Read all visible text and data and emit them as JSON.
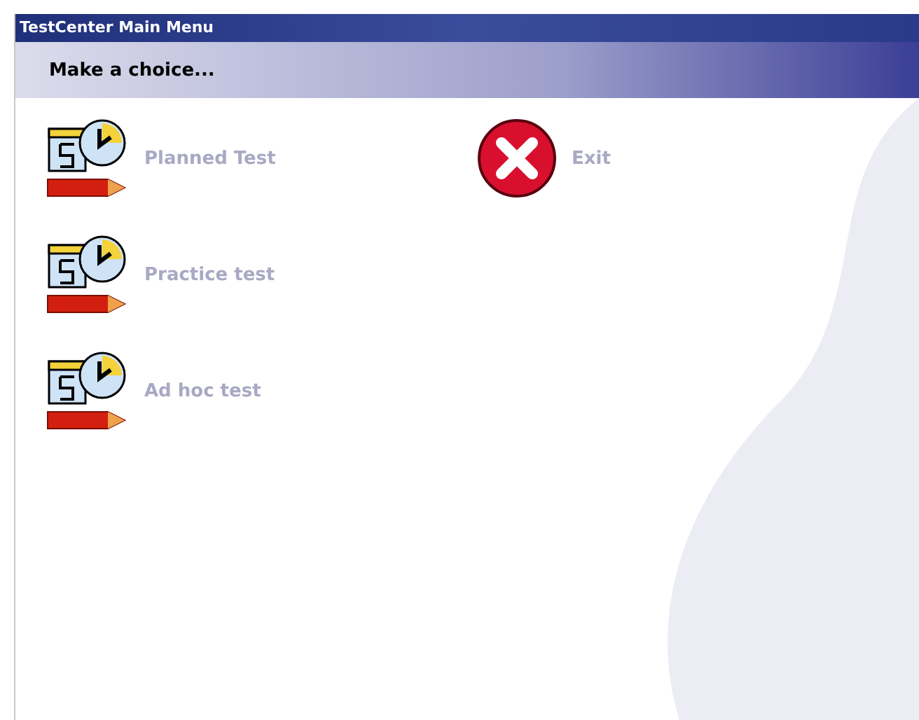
{
  "window": {
    "title": "TestCenter Main Menu"
  },
  "header": {
    "text": "Make a choice..."
  },
  "columns": [
    [
      {
        "label": "Planned Test",
        "kind": "test"
      },
      {
        "label": "Practice test",
        "kind": "test"
      },
      {
        "label": "Ad hoc test",
        "kind": "test"
      }
    ],
    [
      {
        "label": "Exit",
        "kind": "exit"
      }
    ]
  ]
}
